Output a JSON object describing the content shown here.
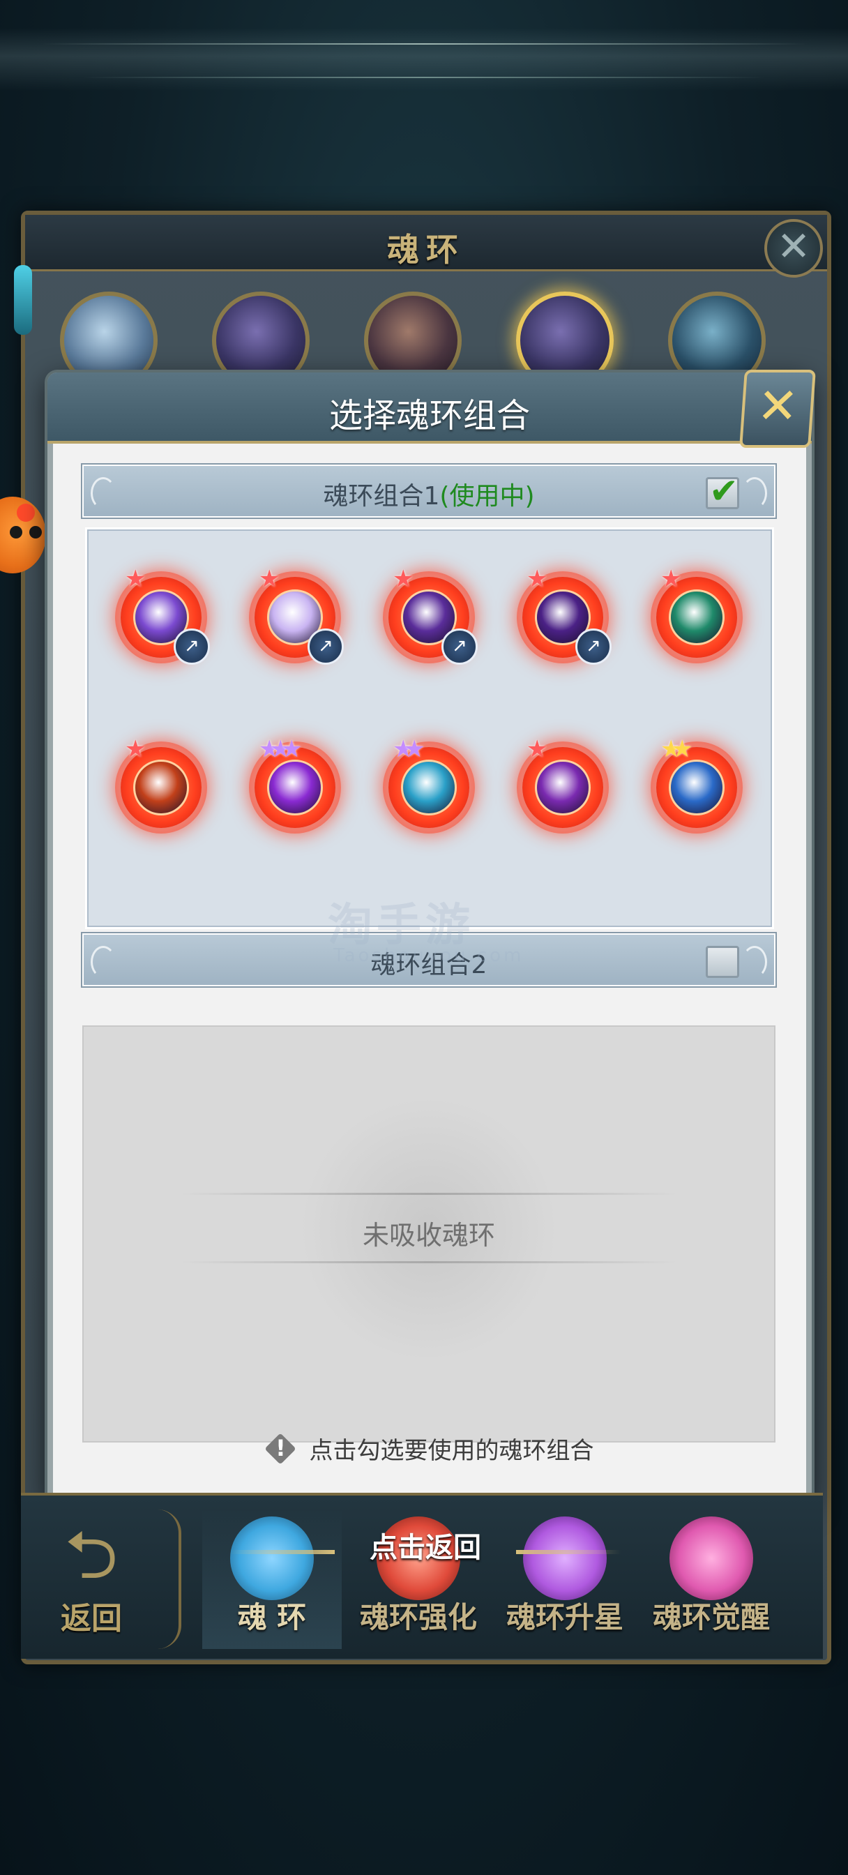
{
  "back_window": {
    "title": "魂环",
    "close_icon": "✕"
  },
  "modal": {
    "title": "选择魂环组合",
    "close_icon": "✕",
    "group1": {
      "label": "魂环组合1",
      "status": "(使用中)",
      "checked": true
    },
    "group2": {
      "label": "魂环组合2",
      "checked": false,
      "empty_text": "未吸收魂环"
    },
    "hint": "点击勾选要使用的魂环组合"
  },
  "rings": [
    {
      "icon": "purple-crystal-ring-icon",
      "stars": 1,
      "star_color": "#ff5a5a",
      "badge": "bird-badge-icon",
      "color": "#7b4ad0"
    },
    {
      "icon": "white-moon-ring-icon",
      "stars": 1,
      "star_color": "#ff5a5a",
      "badge": "bird-badge-icon",
      "color": "#c9b4f2"
    },
    {
      "icon": "purple-dragon-ring-icon",
      "stars": 1,
      "star_color": "#ff5a5a",
      "badge": "bird-badge-icon",
      "color": "#5a2d9a"
    },
    {
      "icon": "shadow-dragon-ring-icon",
      "stars": 1,
      "star_color": "#ff5a5a",
      "badge": "bird-badge-icon",
      "color": "#4b2186"
    },
    {
      "icon": "green-wings-ring-icon",
      "stars": 1,
      "star_color": "#ff5a5a",
      "badge": null,
      "color": "#1f8a6a"
    },
    {
      "icon": "fire-demon-ring-icon",
      "stars": 1,
      "star_color": "#ff5a5a",
      "badge": null,
      "color": "#c2401a"
    },
    {
      "icon": "violet-beast-ring-icon",
      "stars": 3,
      "star_color": "#c48cff",
      "badge": null,
      "color": "#8a2ad2"
    },
    {
      "icon": "ice-warrior-ring-icon",
      "stars": 2,
      "star_color": "#c48cff",
      "badge": null,
      "color": "#2aa0c8"
    },
    {
      "icon": "purple-skull-ring-icon",
      "stars": 1,
      "star_color": "#ff5a5a",
      "badge": null,
      "color": "#7a2ab0"
    },
    {
      "icon": "frost-beast-ring-icon",
      "stars": 2,
      "star_color": "#ffd84a",
      "badge": null,
      "color": "#2a6ac8"
    }
  ],
  "watermark": {
    "text": "淘手游",
    "sub": "Taoshouyou.com"
  },
  "bottom_nav": {
    "back_label": "返回",
    "back_icon": "return-arrow-icon",
    "tap_return": "点击返回",
    "tabs": [
      {
        "label": "魂 环",
        "gem_color": "#3fa8e0",
        "active": true
      },
      {
        "label": "魂环强化",
        "gem_color": "#e04a3a",
        "active": false
      },
      {
        "label": "魂环升星",
        "gem_color": "#b05ae0",
        "active": false
      },
      {
        "label": "魂环觉醒",
        "gem_color": "#e05ab0",
        "active": false
      }
    ]
  }
}
